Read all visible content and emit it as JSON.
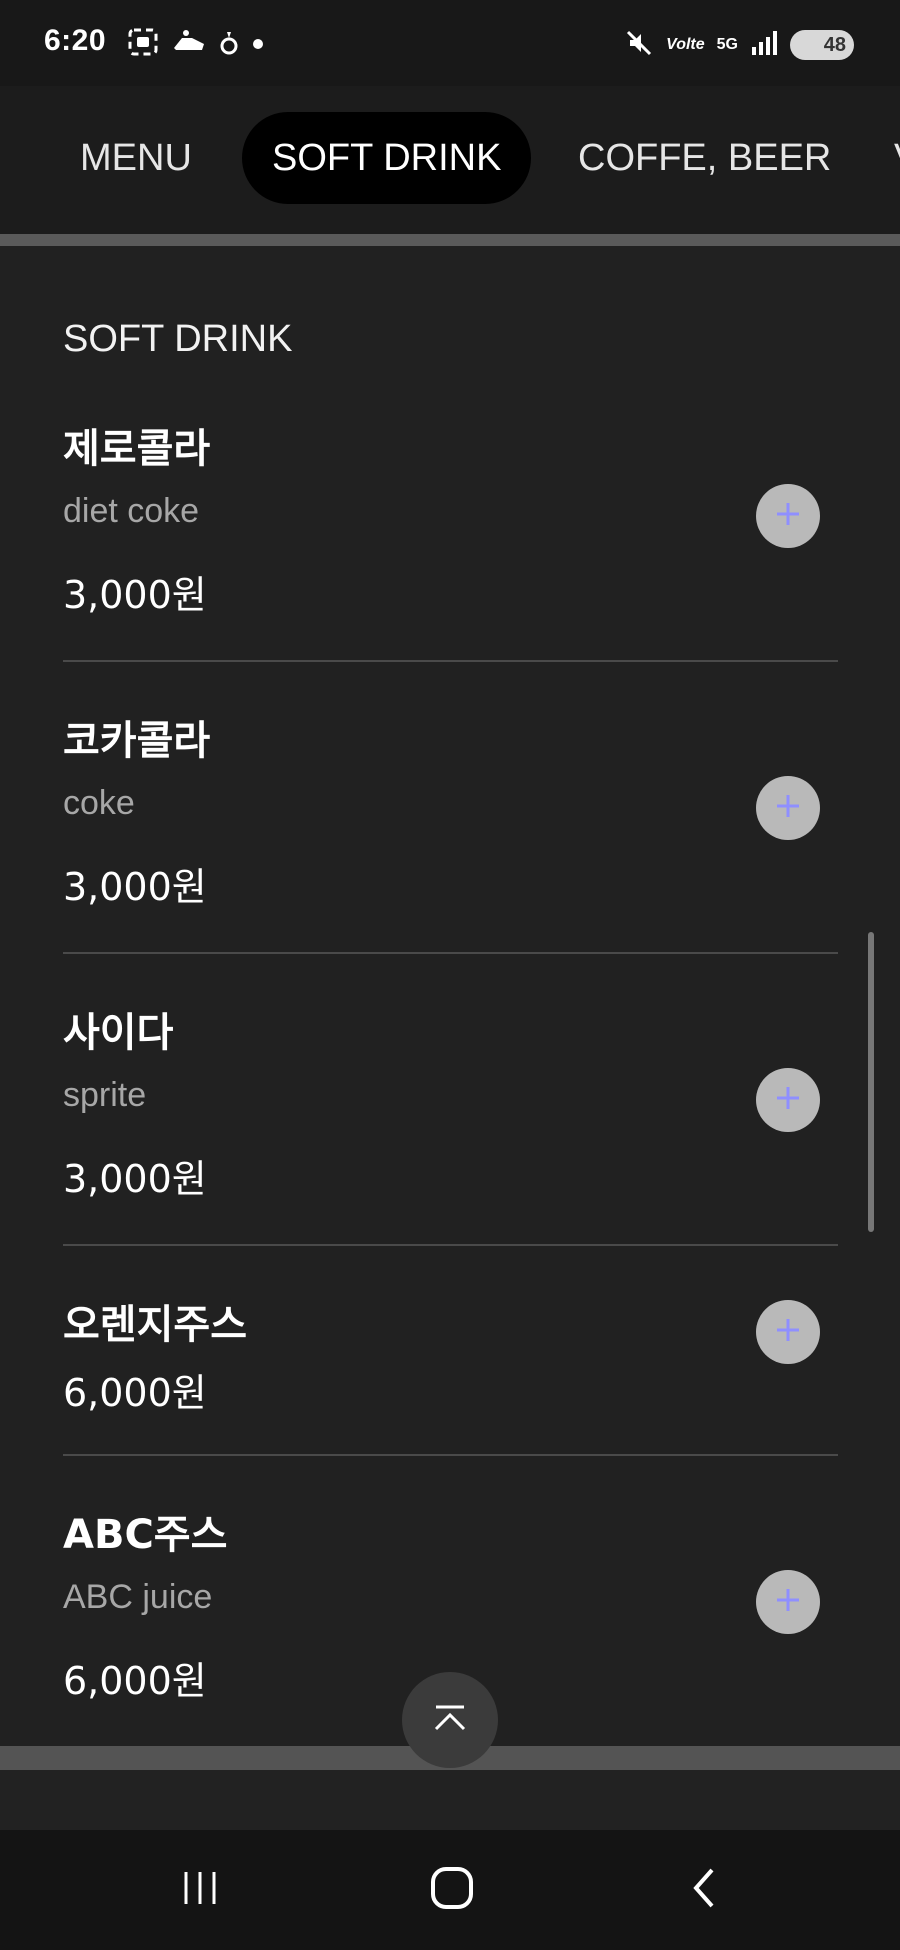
{
  "status_bar": {
    "time": "6:20",
    "battery": "48",
    "network": "5G",
    "volte": "Volte"
  },
  "tabs": [
    {
      "label": "MENU",
      "active": false
    },
    {
      "label": "SOFT DRINK",
      "active": true
    },
    {
      "label": "COFFE, BEER",
      "active": false
    }
  ],
  "section": {
    "title": "SOFT DRINK"
  },
  "items": [
    {
      "name": "제로콜라",
      "desc": "diet coke",
      "price": "3,000원"
    },
    {
      "name": "코카콜라",
      "desc": "coke",
      "price": "3,000원"
    },
    {
      "name": "사이다",
      "desc": "sprite",
      "price": "3,000원"
    },
    {
      "name": "오렌지주스",
      "desc": "",
      "price": "6,000원"
    },
    {
      "name": "ABC주스",
      "desc": "ABC juice",
      "price": "6,000원"
    }
  ],
  "colors": {
    "background": "#212121",
    "header": "#1c1c1c",
    "active_tab": "#000000",
    "plus_icon": "#8f8fff",
    "add_button": "#b9b9b9"
  },
  "icons": {
    "add": "plus-icon",
    "scroll_top": "chevron-up-icon",
    "nav_recent": "recent-apps-icon",
    "nav_home": "home-icon",
    "nav_back": "back-icon"
  }
}
